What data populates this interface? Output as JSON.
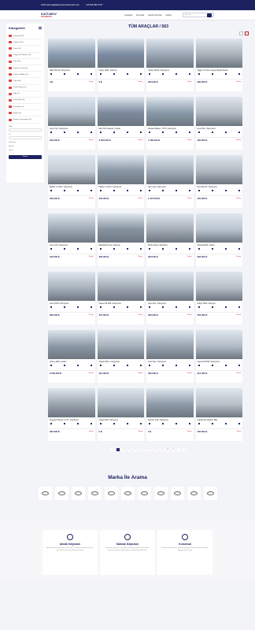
{
  "topbar": {
    "email": "KATumaumsa@katumaumsaotomotiv.com",
    "phone": "+90 532 384 57 87"
  },
  "header": {
    "logo_main": "KATUMOV",
    "logo_sub": "OTOMOTİV",
    "nav": [
      "Anasayfa",
      "Kurumsal",
      "Kayıtlı Kurumsal",
      "İletişim"
    ],
    "search_placeholder": "Araç ara..."
  },
  "sidebar": {
    "title": "Kategoriler",
    "categories": [
      "Kamyonet (82)",
      "Kamyon (130)",
      "Çekici (54)",
      "Kamyonet & Minibüs (12)",
      "Dorse (20)",
      "Kamyon & Çekici (3)",
      "Otobüs & Midibüs (5)",
      "Çekici (40)",
      "Kiralık Kamyon (2)",
      "Diğer (1)",
      "İş Makinaları (4)",
      "Tarım Aracı (3)",
      "Minibüs (3)",
      "Kamyon & Kamyonet (10)"
    ],
    "filter_label_1": "Fiyat",
    "filter_label_2": "Yıl",
    "filter_label_3": "Yakıt Tipi",
    "filter_opt1": "Benzin",
    "filter_opt2": "Dizel",
    "filter_button": "Filtrele"
  },
  "main": {
    "title": "TÜM ARAÇLAR / 563"
  },
  "cars": [
    {
      "name": "Daily 50C15 / Kamyonet",
      "price": "0 ₺",
      "c": "#8a9bb0"
    },
    {
      "name": "Cargo 1846 / Kamyon",
      "price": "0 ₺",
      "c": "#7a8aa0"
    },
    {
      "name": "Canter FE 85 / Kamyonet",
      "price": "950.000 ₺",
      "c": "#9aa6b4"
    },
    {
      "name": "Tigger 1.5 Fire Lounge Rzaka Sedan",
      "price": "990.000 ₺",
      "c": "#a8b0b8"
    },
    {
      "name": "Iveco 70c / Kamyonet",
      "price": "490.000 ₺",
      "c": "#b8c4d0"
    },
    {
      "name": "Man TGX Sleeper / Çekici",
      "price": "2.250.000 ₺",
      "c": "#7c8a9c"
    },
    {
      "name": "Renault Master / 3.5T / Kamyonet",
      "price": "1.790.000 ₺",
      "c": "#8898a8"
    },
    {
      "name": "Iveco 65c / Kamyonet",
      "price": "490.000 ₺",
      "c": "#b4bcc4"
    },
    {
      "name": "Master 2.3 DCI / Kamyonet",
      "price": "420.000 ₺",
      "c": "#c4ccd4"
    },
    {
      "name": "Master 2.3 DCI / Kamyonet",
      "price": "430.000 ₺",
      "c": "#8896a4"
    },
    {
      "name": "Nqr Long / Kamyonet",
      "price": "1.475.000 ₺",
      "c": "#a2aeba"
    },
    {
      "name": "Hyundai H1 / Kamyonet",
      "price": "465.000 ₺",
      "c": "#b0b8c0"
    },
    {
      "name": "Iveco 14n / Kamyonet",
      "price": "342.000 ₺",
      "c": "#9ca8b4"
    },
    {
      "name": "Mitsubishi Fuso / Kamyon",
      "price": "390.000 ₺",
      "c": "#86939f"
    },
    {
      "name": "Dorse Kaya / Sal Dorse",
      "price": "280.000 ₺",
      "c": "#a4adb6"
    },
    {
      "name": "Scania R420 / Çekici",
      "price": "990.000 ₺",
      "c": "#bac4ce"
    },
    {
      "name": "Isuzu NKR / Kamyonet",
      "price": "280.000 ₺",
      "c": "#a8b2bc"
    },
    {
      "name": "Canter FE 659 / Kamyonet",
      "price": "375.000 ₺",
      "c": "#9fa9b3"
    },
    {
      "name": "Isuzu Npr / Kamyonet",
      "price": "483.000 ₺",
      "c": "#aab4be"
    },
    {
      "name": "Cargo 2520 / Kamyon",
      "price": "550.000 ₺",
      "c": "#b6bec6"
    },
    {
      "name": "Actros 1844 / Çekici",
      "price": "2.250.000 ₺",
      "c": "#8c99a6"
    },
    {
      "name": "Transit 350 L / Kamyonet",
      "price": "310.000 ₺",
      "c": "#a5b0bb"
    },
    {
      "name": "Isuzu Npr / Kamyonet",
      "price": "485.000 ₺",
      "c": "#98a4b0"
    },
    {
      "name": "Canter FE 659 / Kamyonet",
      "price": "310.000 ₺",
      "c": "#b2bcc6"
    },
    {
      "name": "Peugeot Partner 1.6 H / Combimat",
      "price": "295.000 ₺",
      "c": "#9aa4ae"
    },
    {
      "name": "Jumbo 500 / Kamyonet",
      "price": "0 ₺",
      "c": "#aeb8c2"
    },
    {
      "name": "Sprinter 416 / Kamyonet",
      "price": "0 ₺",
      "c": "#8e9ba8"
    },
    {
      "name": "Kubota 4% Çekimli Tiller",
      "price": "195.000 ₺",
      "c": "#b8c0c8"
    }
  ],
  "card_labels": {
    "detail": "Detay"
  },
  "pagination": [
    "‹",
    "1",
    "2",
    "3",
    "4",
    "5",
    "6",
    "7",
    "8",
    "9",
    "10",
    "11",
    "›",
    "»"
  ],
  "brands_title": "Marka İle Arama",
  "features": [
    {
      "title": "Almak İstiyorum",
      "text": "Aracı alırken ne durumda ise Katumav Otomotiv araçlarını sizin için özel olarak ön ögün profesyonel olarak."
    },
    {
      "title": "Satmak İstiyorum",
      "text": "Aracınızı satmak için en doğru yerdesiniz. Katumav Otomotiv aracınızı ücretsiz değerlendirip en doğru fiyatı teklif eder."
    },
    {
      "title": "Kurumsal",
      "text": "Katumav Otomotiv kurumsal müşterilerine özel çözümler sunar, filo ihtiyaçlarınızı karşılar."
    }
  ]
}
